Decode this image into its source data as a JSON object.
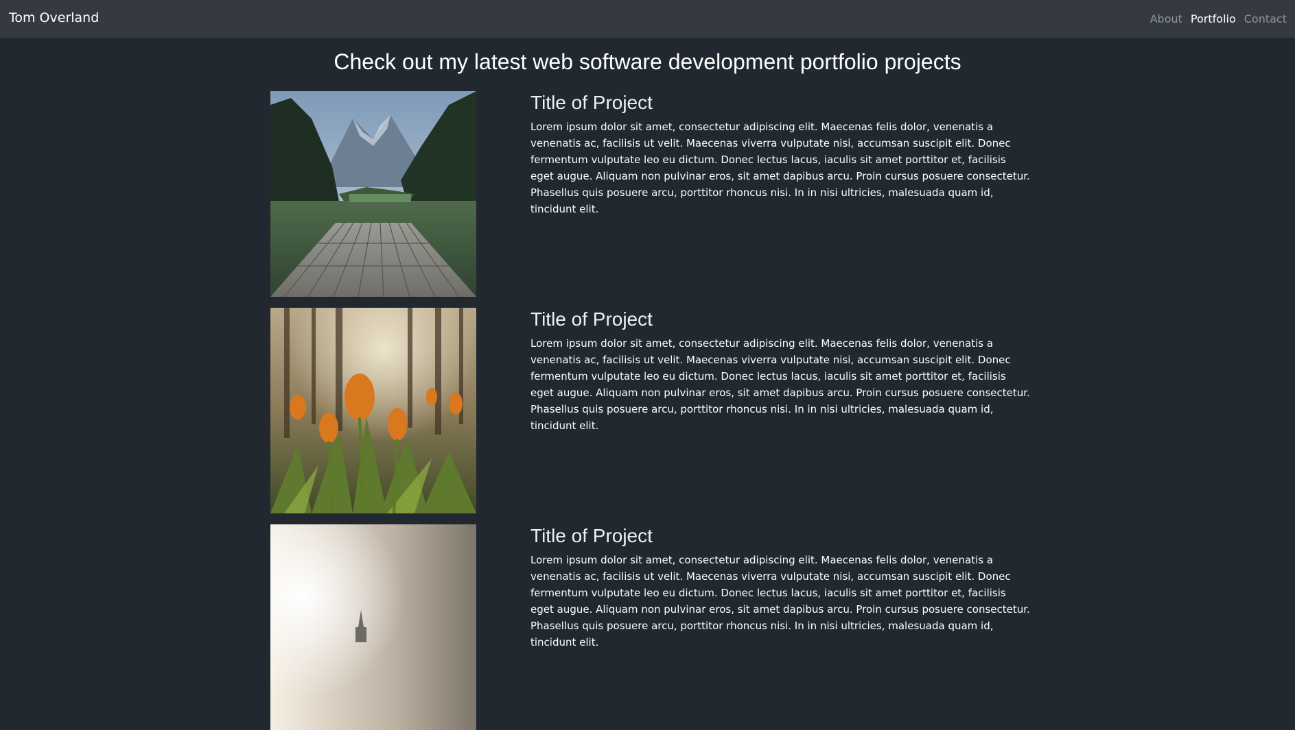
{
  "navbar": {
    "brand": "Tom Overland",
    "links": [
      {
        "label": "About",
        "active": false
      },
      {
        "label": "Portfolio",
        "active": true
      },
      {
        "label": "Contact",
        "active": false
      }
    ]
  },
  "main": {
    "heading": "Check out my latest web software development portfolio projects",
    "projects": [
      {
        "image": "lake-dock-mountains",
        "title": "Title of Project",
        "description": "Lorem ipsum dolor sit amet, consectetur adipiscing elit. Maecenas felis dolor, venenatis a venenatis ac, facilisis ut velit. Maecenas viverra vulputate nisi, accumsan suscipit elit. Donec fermentum vulputate leo eu dictum. Donec lectus lacus, iaculis sit amet porttitor et, facilisis eget augue. Aliquam non pulvinar eros, sit amet dapibus arcu. Proin cursus posuere consectetur. Phasellus quis posuere arcu, porttitor rhoncus nisi. In in nisi ultricies, malesuada quam id, tincidunt elit."
      },
      {
        "image": "orange-tulips-forest",
        "title": "Title of Project",
        "description": "Lorem ipsum dolor sit amet, consectetur adipiscing elit. Maecenas felis dolor, venenatis a venenatis ac, facilisis ut velit. Maecenas viverra vulputate nisi, accumsan suscipit elit. Donec fermentum vulputate leo eu dictum. Donec lectus lacus, iaculis sit amet porttitor et, facilisis eget augue. Aliquam non pulvinar eros, sit amet dapibus arcu. Proin cursus posuere consectetur. Phasellus quis posuere arcu, porttitor rhoncus nisi. In in nisi ultricies, malesuada quam id, tincidunt elit."
      },
      {
        "image": "foggy-sunlight",
        "title": "Title of Project",
        "description": "Lorem ipsum dolor sit amet, consectetur adipiscing elit. Maecenas felis dolor, venenatis a venenatis ac, facilisis ut velit. Maecenas viverra vulputate nisi, accumsan suscipit elit. Donec fermentum vulputate leo eu dictum. Donec lectus lacus, iaculis sit amet porttitor et, facilisis eget augue. Aliquam non pulvinar eros, sit amet dapibus arcu. Proin cursus posuere consectetur. Phasellus quis posuere arcu, porttitor rhoncus nisi. In in nisi ultricies, malesuada quam id, tincidunt elit."
      }
    ]
  },
  "colors": {
    "background": "#212830",
    "navbar": "#343a40",
    "nav_inactive": "#8d949a",
    "nav_active": "#ffffff",
    "project_title": "#e6f6f8"
  }
}
